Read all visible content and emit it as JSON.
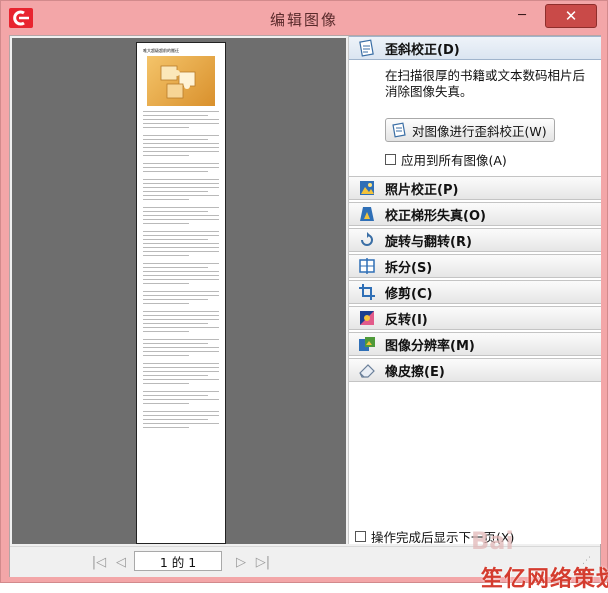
{
  "window": {
    "title": "编辑图像"
  },
  "controls": {
    "minimize": "─",
    "maximize": "□",
    "close": "✕"
  },
  "preview": {
    "page_heading": "唯大超级超前的搬迁",
    "page_image_icon": "puzzle-image"
  },
  "sidebar": {
    "skew": {
      "label": "歪斜校正(D)",
      "description": "在扫描很厚的书籍或文本数码相片后消除图像失真。",
      "button_label": "对图像进行歪斜校正(W)",
      "checkbox_label": "应用到所有图像(A)",
      "checkbox_checked": false
    },
    "sections": [
      {
        "label": "照片校正(P)",
        "icon": "photo-icon"
      },
      {
        "label": "校正梯形失真(O)",
        "icon": "trapezoid-icon"
      },
      {
        "label": "旋转与翻转(R)",
        "icon": "rotate-icon"
      },
      {
        "label": "拆分(S)",
        "icon": "split-icon"
      },
      {
        "label": "修剪(C)",
        "icon": "crop-icon"
      },
      {
        "label": "反转(I)",
        "icon": "invert-icon"
      },
      {
        "label": "图像分辨率(M)",
        "icon": "resolution-icon"
      },
      {
        "label": "橡皮擦(E)",
        "icon": "eraser-icon"
      }
    ],
    "bottom_checkbox": {
      "label": "操作完成后显示下一页(X)",
      "checked": false
    }
  },
  "pager": {
    "first": "|◁",
    "prev": "◁",
    "value": "1 的 1",
    "next": "▷",
    "last": "▷|"
  },
  "watermark": {
    "faint": "Bai",
    "brand": "笙亿网络策划"
  },
  "colors": {
    "title_bar": "#f3a6a8",
    "close_button": "#c94a48",
    "active_section": "#dbe5f1"
  }
}
